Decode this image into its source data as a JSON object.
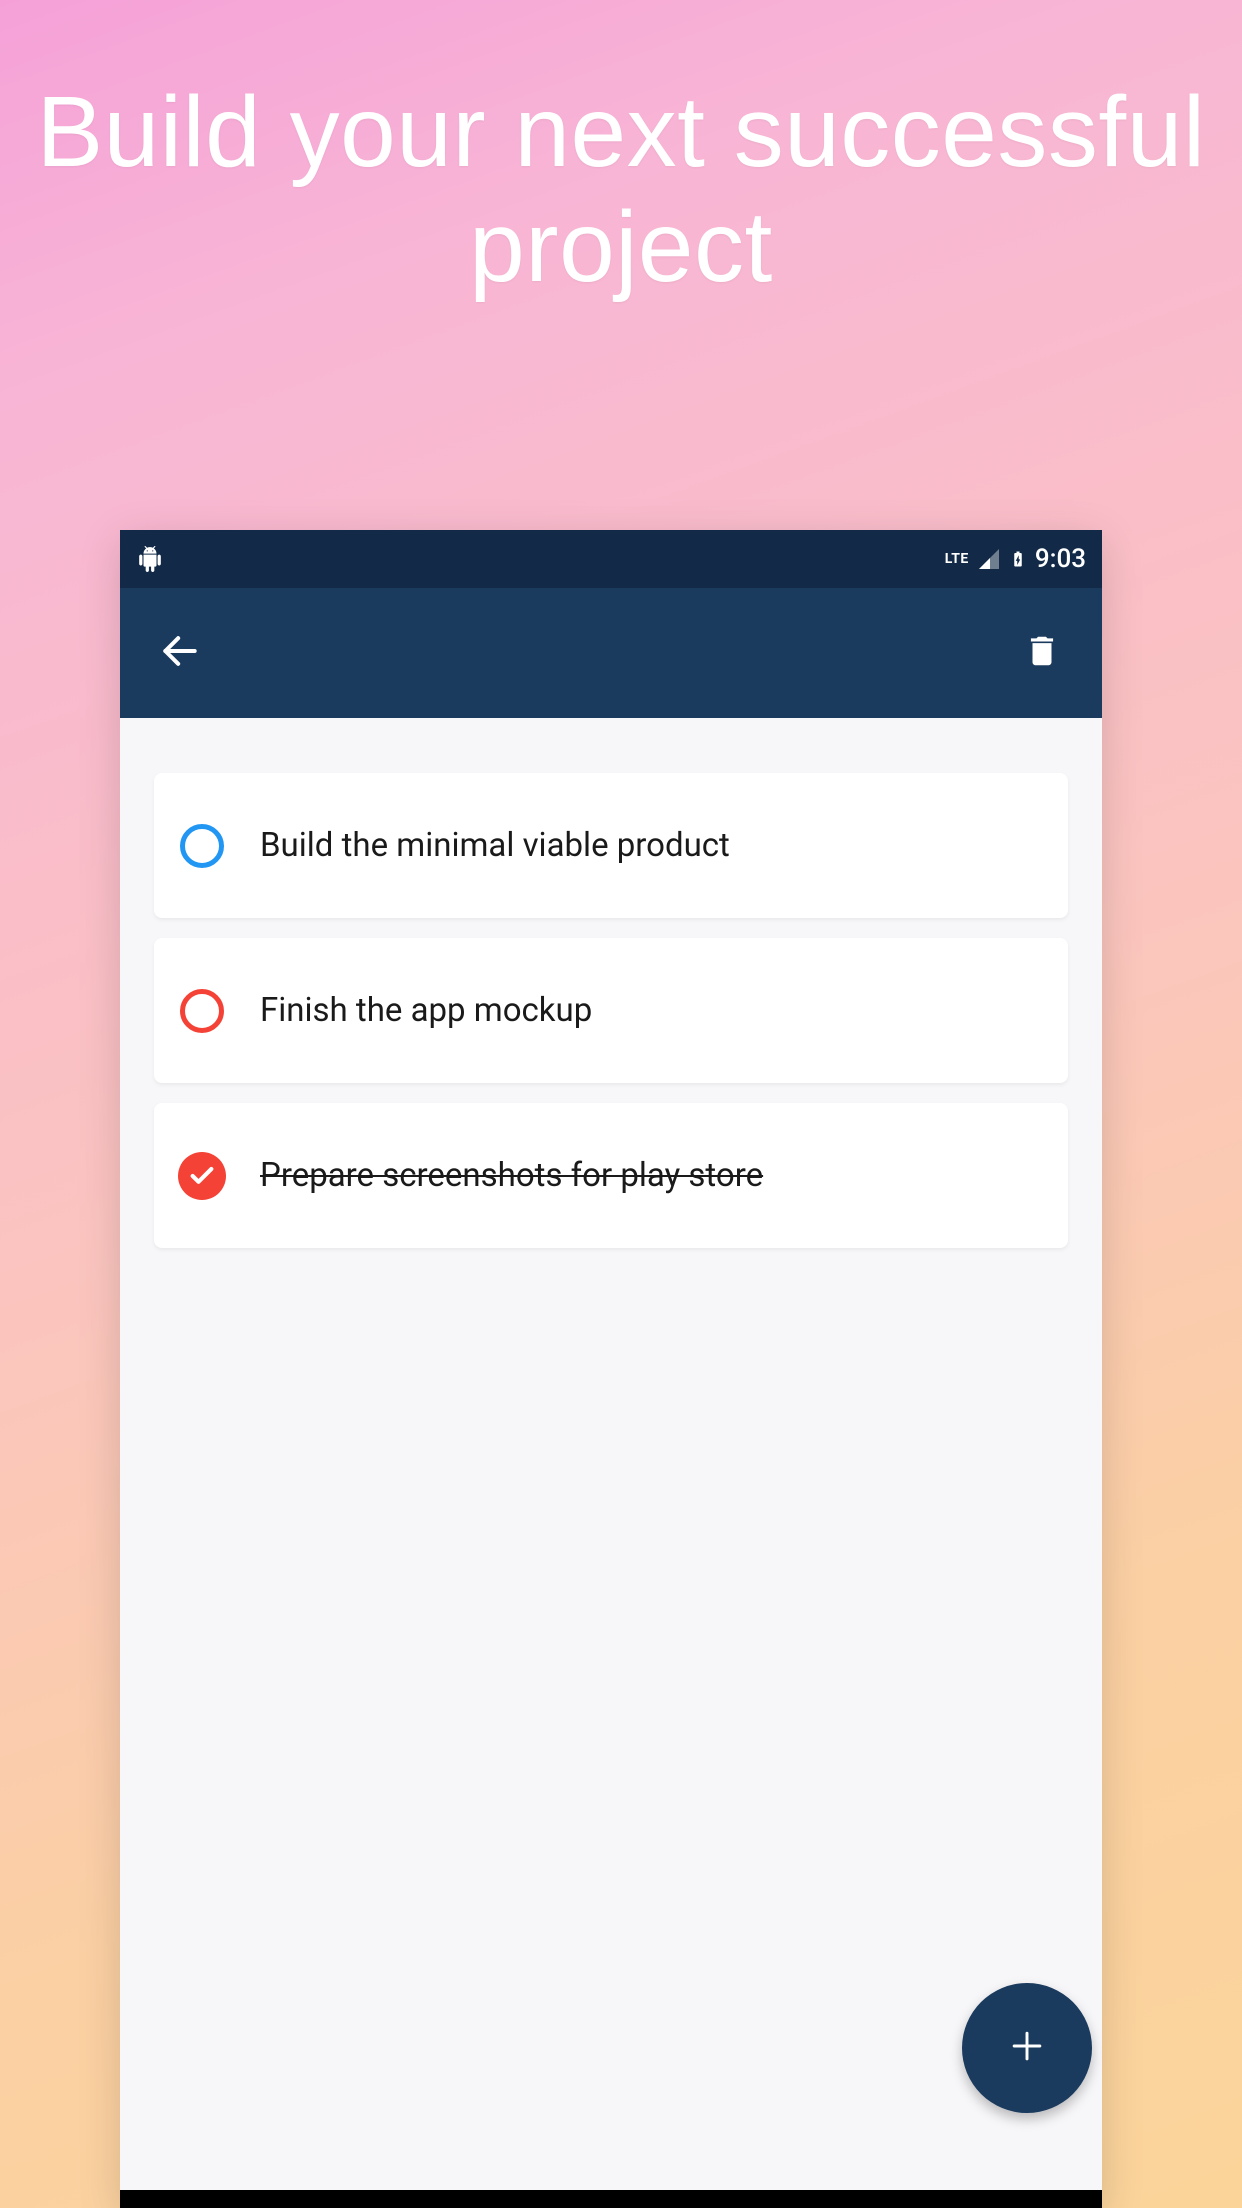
{
  "promo": {
    "title": "Build your next successful project"
  },
  "statusBar": {
    "network": "LTE",
    "time": "9:03"
  },
  "tasks": [
    {
      "label": "Build the minimal viable product",
      "completed": false,
      "checkboxColor": "blue"
    },
    {
      "label": "Finish the app mockup",
      "completed": false,
      "checkboxColor": "red"
    },
    {
      "label": "Prepare screenshots for play store",
      "completed": true,
      "checkboxColor": "red"
    }
  ],
  "colors": {
    "appBar": "#1a3a5e",
    "statusBar": "#122a47",
    "fab": "#1a3a5e",
    "checkBlue": "#2196f3",
    "checkRed": "#f44336"
  }
}
